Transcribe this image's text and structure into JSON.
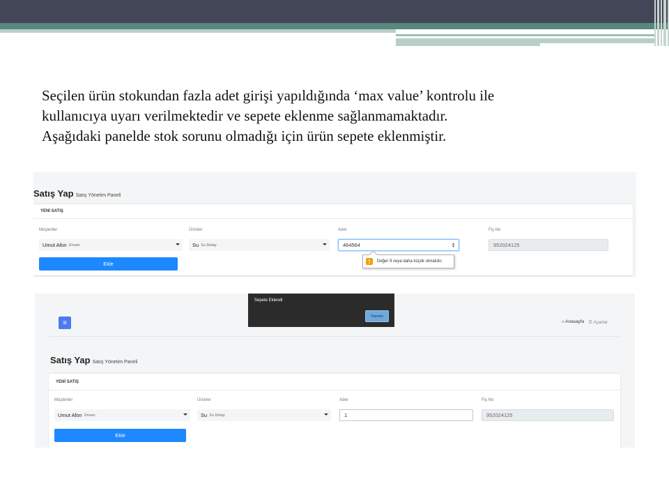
{
  "slide": {
    "lines": [
      "Seçilen ürün stokundan fazla adet girişi yapıldığında ‘max value’ kontrolu ile",
      "kullanıcıya uyarı verilmektedir ve sepete eklenme sağlanmamaktadır.",
      "Aşağıdaki panelde stok sorunu olmadığı için ürün sepete eklenmiştir."
    ]
  },
  "colors": {
    "header_dark": "#434656",
    "header_teal": "#58877d",
    "primary_button": "#1e88ff",
    "warning": "#f0a000"
  },
  "screenshot1": {
    "page_title": "Satış Yap",
    "page_subtitle": "Satış Yönetim Paneli",
    "card_title": "YENİ SATIŞ",
    "labels": {
      "customers": "Müşteriler",
      "products": "Ürünler",
      "quantity": "Adet",
      "receipt": "Fiş No"
    },
    "customer_name": "Umut Altın",
    "customer_title": "Ünvan",
    "product_name": "Su",
    "product_detail": "Su Detay",
    "quantity_value": "464564",
    "receipt_no": "952024125",
    "add_button": "Ekle",
    "tooltip_icon": "warning-icon",
    "tooltip_text": "Değer 9 veya daha küçük olmalıdır."
  },
  "screenshot2": {
    "modal_title": "Sepete Eklendi",
    "modal_button": "Tamam",
    "menu_icon": "hamburger-icon",
    "nav_home": "Anasayfa",
    "nav_settings": "Ayarlar",
    "page_title": "Satış Yap",
    "page_subtitle": "Satış Yönetim Paneli",
    "card_title": "YENİ SATIŞ",
    "labels": {
      "customers": "Müşteriler",
      "products": "Ürünler",
      "quantity": "Adet",
      "receipt": "Fiş No"
    },
    "customer_name": "Umut Altın",
    "customer_title": "Ünvan",
    "product_name": "Su",
    "product_detail": "Su Detay",
    "quantity_value": "1",
    "receipt_no": "952024125",
    "add_button": "Ekle"
  }
}
